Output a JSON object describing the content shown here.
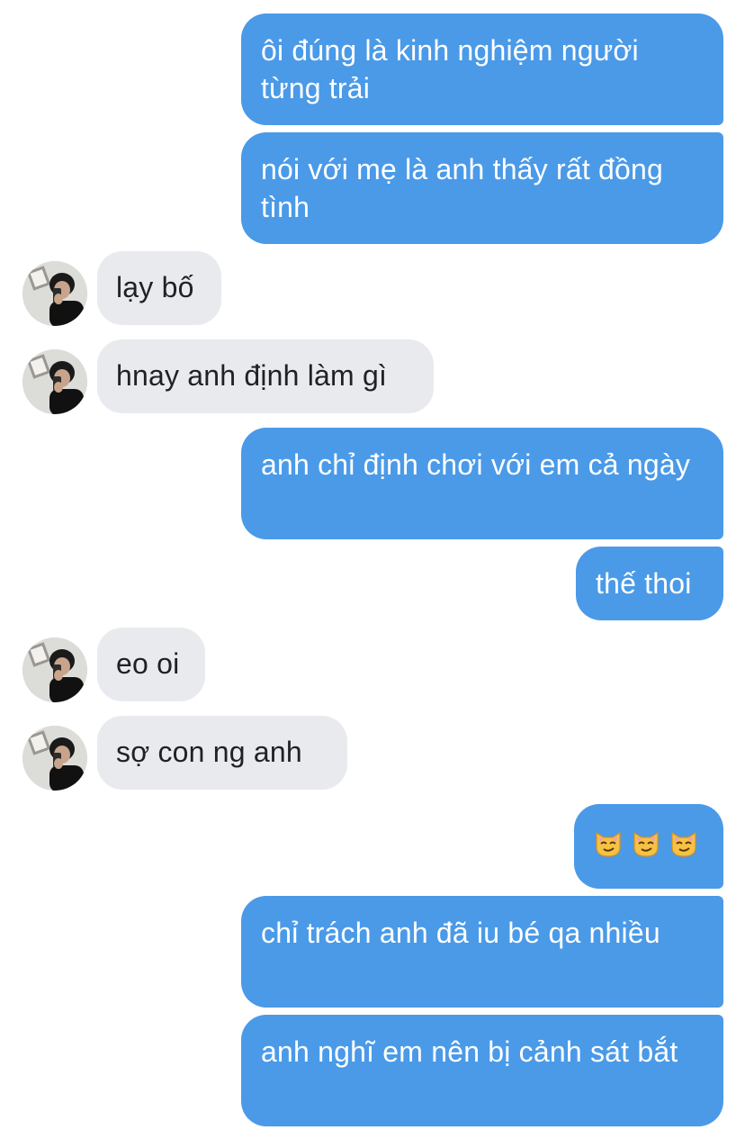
{
  "messages": [
    {
      "sender": "me",
      "text": "ôi đúng là kinh nghiệm người từng trải"
    },
    {
      "sender": "me",
      "text": "nói với mẹ là anh thấy rất đồng tình"
    },
    {
      "sender": "them",
      "text": "lạy bố"
    },
    {
      "sender": "them",
      "text": "hnay anh định làm gì"
    },
    {
      "sender": "me",
      "text": "anh chỉ định chơi với em cả ngày"
    },
    {
      "sender": "me",
      "text": "thế thoi"
    },
    {
      "sender": "them",
      "text": "eo oi"
    },
    {
      "sender": "them",
      "text": "sợ con ng anh"
    },
    {
      "sender": "me",
      "emoji": [
        "smirking-cat-face-icon",
        "smirking-cat-face-icon",
        "smirking-cat-face-icon"
      ]
    },
    {
      "sender": "me",
      "text": "chỉ trách anh đã iu bé qa nhiều"
    },
    {
      "sender": "me",
      "text": "anh nghĩ em nên bị cảnh sát bắt"
    }
  ],
  "colors": {
    "outgoing_bubble": "#4a9ae8",
    "incoming_bubble": "#e9eaee",
    "outgoing_text": "#ffffff",
    "incoming_text": "#1f2124"
  }
}
